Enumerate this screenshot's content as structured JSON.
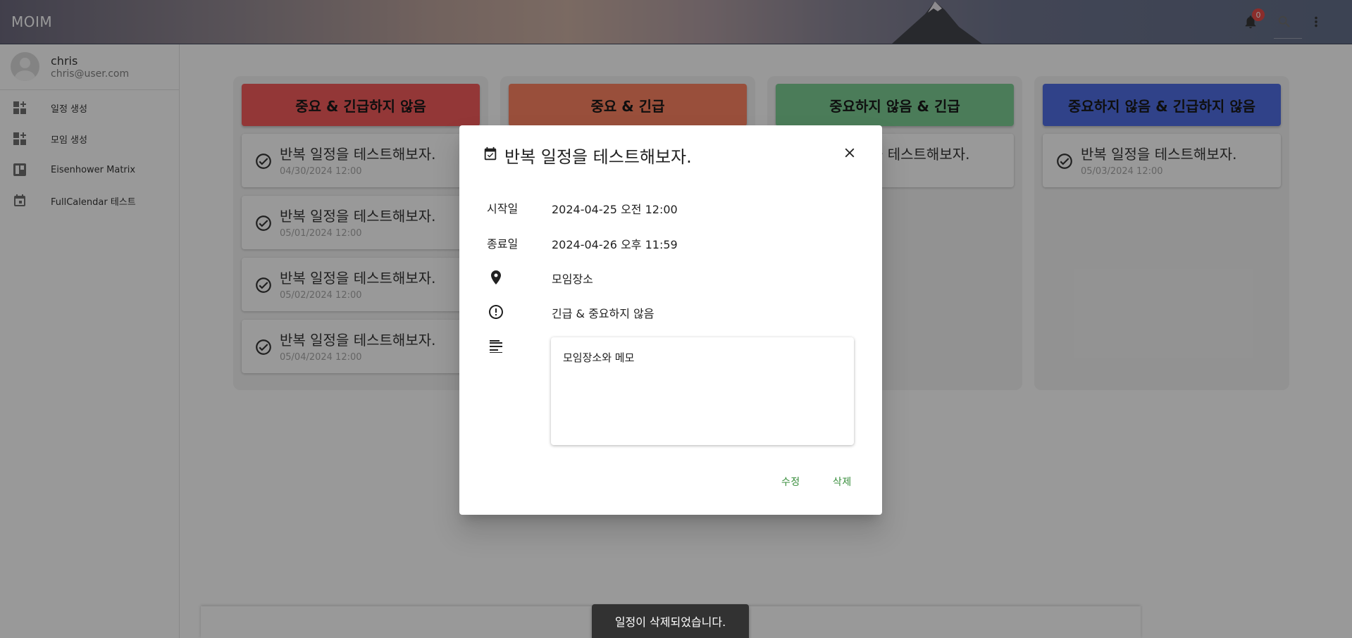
{
  "app": {
    "brand": "MOIM",
    "notification_count": "0",
    "colors": {
      "appbar_dark": "#53607e",
      "appbar_warm": "#c7a89a",
      "badge": "#e53935",
      "action_text": "#388e3c"
    }
  },
  "topbar": {
    "icons": [
      "bell-icon",
      "search-icon",
      "more-vert-icon"
    ]
  },
  "sidebar": {
    "user": {
      "name": "chris",
      "email": "chris@user.com"
    },
    "items": [
      {
        "label": "일정 생성",
        "icon": "dashboard-add-icon"
      },
      {
        "label": "모임 생성",
        "icon": "dashboard-add-icon"
      },
      {
        "label": "Eisenhower Matrix",
        "icon": "board-icon"
      },
      {
        "label": "FullCalendar 테스트",
        "icon": "calendar-icon"
      }
    ]
  },
  "matrix": {
    "columns": [
      {
        "title": "중요 & 긴급하지 않음",
        "color": "#f44b4b",
        "cards": [
          {
            "title": "반복 일정을 테스트해보자.",
            "date": "04/30/2024 12:00"
          },
          {
            "title": "반복 일정을 테스트해보자.",
            "date": "05/01/2024 12:00"
          },
          {
            "title": "반복 일정을 테스트해보자.",
            "date": "05/02/2024 12:00"
          },
          {
            "title": "반복 일정을 테스트해보자.",
            "date": "05/04/2024 12:00"
          }
        ]
      },
      {
        "title": "중요 & 긴급",
        "color": "#ff7652",
        "cards": []
      },
      {
        "title": "중요하지 않음 & 긴급",
        "color": "#6fc98a",
        "cards": [
          {
            "title": "반복 일정을 테스트해보자.",
            "date": ""
          }
        ]
      },
      {
        "title": "중요하지 않음 & 긴급하지 않음",
        "color": "#3d5ee1",
        "cards": [
          {
            "title": "반복 일정을 테스트해보자.",
            "date": "05/03/2024 12:00"
          }
        ]
      }
    ]
  },
  "dialog": {
    "title": "반복 일정을 테스트해보자.",
    "start_label": "시작일",
    "start_value": "2024-04-25 오전 12:00",
    "end_label": "종료일",
    "end_value": "2024-04-26 오후 11:59",
    "location": "모임장소",
    "priority": "긴급 & 중요하지 않음",
    "memo": "모임장소와 메모",
    "edit_label": "수정",
    "delete_label": "삭제"
  },
  "snackbar": {
    "message": "일정이 삭제되었습니다."
  }
}
